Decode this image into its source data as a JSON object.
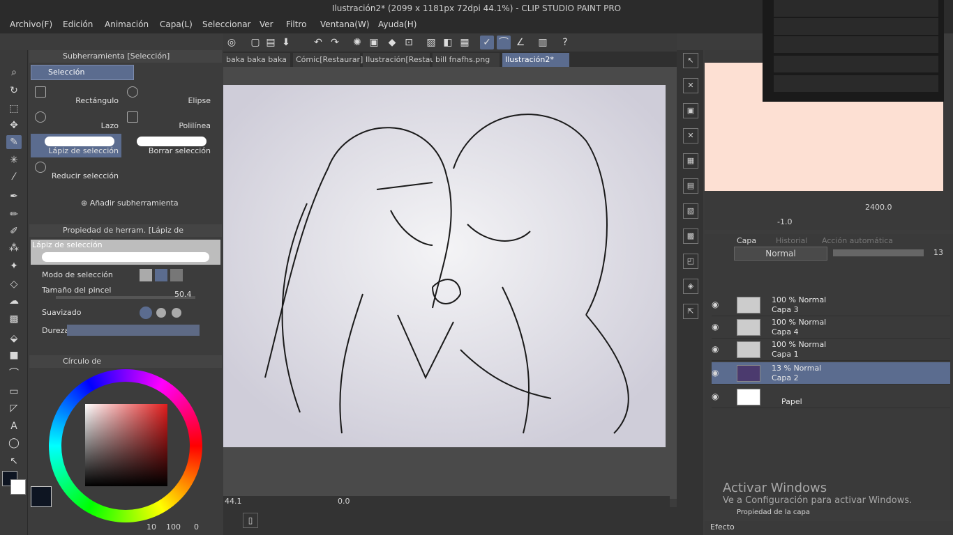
{
  "window": {
    "title": "Ilustración2* (2099 x 1181px 72dpi 44.1%)  - CLIP STUDIO PAINT PRO"
  },
  "menu": [
    "Archivo(F)",
    "Edición",
    "Animación",
    "Capa(L)",
    "Seleccionar",
    "Ver",
    "Filtro",
    "Ventana(W)",
    "Ayuda(H)"
  ],
  "sub_tool_panel": {
    "title": "Subherramienta [Selección]",
    "group_tab": "Selección",
    "tools": [
      "Rectángulo",
      "Elipse",
      "Lazo",
      "Polilínea",
      "Lápiz de selección",
      "Borrar selección",
      "Reducir selección"
    ],
    "add_label": "Añadir subherramienta"
  },
  "tool_property": {
    "title": "Propiedad de herram. [Lápiz de selección]",
    "preview_label": "Lápiz de selección",
    "mode_label": "Modo de selección",
    "size_label": "Tamaño del pincel",
    "size_value": "50.4",
    "smooth_label": "Suavizado",
    "hardness_label": "Dureza"
  },
  "color_panel": {
    "title": "Círculo de",
    "footer_a": "10",
    "footer_b": "100",
    "footer_c": "0"
  },
  "doc_tabs": [
    "baka baka baka",
    "Cómic[Restaurar]",
    "Ilustración[Restaurar]",
    "bill fnafhs.png",
    "Ilustración2*"
  ],
  "status": {
    "zoom": "44.1",
    "angle": "0.0"
  },
  "navigator": {
    "zoom": "2400.0",
    "rotate": "-1.0"
  },
  "layer_panel": {
    "tab_layer": "Capa",
    "tab_history": "Historial",
    "tab_auto": "Acción automática",
    "blend": "Normal",
    "opacity": "13",
    "layers": [
      {
        "opacity": "100 % Normal",
        "name": "Capa 3"
      },
      {
        "opacity": "100 % Normal",
        "name": "Capa 4"
      },
      {
        "opacity": "100 % Normal",
        "name": "Capa 1"
      },
      {
        "opacity": "13 % Normal",
        "name": "Capa 2"
      }
    ],
    "paper": "Papel"
  },
  "layer_property": {
    "title": "Propiedad de la capa",
    "effect": "Efecto"
  },
  "windows_notice": {
    "line1": "Activar Windows",
    "line2": "Ve a Configuración para activar Windows."
  },
  "colors": {
    "accent": "#5b6c8f",
    "canvas": "#e2dfe6",
    "nav_bg": "#fde0d3"
  }
}
